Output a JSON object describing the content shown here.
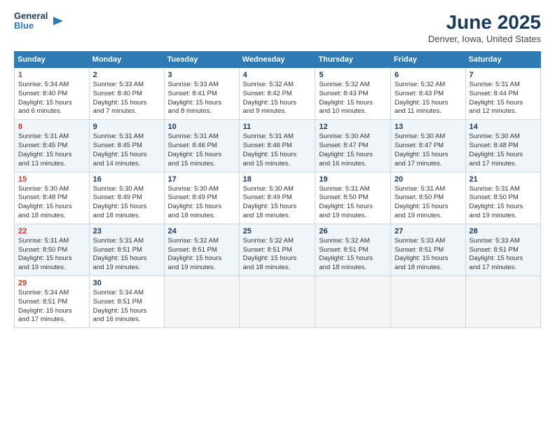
{
  "logo": {
    "line1": "General",
    "line2": "Blue"
  },
  "title": "June 2025",
  "location": "Denver, Iowa, United States",
  "days_of_week": [
    "Sunday",
    "Monday",
    "Tuesday",
    "Wednesday",
    "Thursday",
    "Friday",
    "Saturday"
  ],
  "weeks": [
    [
      {
        "day": "1",
        "info": "Sunrise: 5:34 AM\nSunset: 8:40 PM\nDaylight: 15 hours\nand 6 minutes."
      },
      {
        "day": "2",
        "info": "Sunrise: 5:33 AM\nSunset: 8:40 PM\nDaylight: 15 hours\nand 7 minutes."
      },
      {
        "day": "3",
        "info": "Sunrise: 5:33 AM\nSunset: 8:41 PM\nDaylight: 15 hours\nand 8 minutes."
      },
      {
        "day": "4",
        "info": "Sunrise: 5:32 AM\nSunset: 8:42 PM\nDaylight: 15 hours\nand 9 minutes."
      },
      {
        "day": "5",
        "info": "Sunrise: 5:32 AM\nSunset: 8:43 PM\nDaylight: 15 hours\nand 10 minutes."
      },
      {
        "day": "6",
        "info": "Sunrise: 5:32 AM\nSunset: 8:43 PM\nDaylight: 15 hours\nand 11 minutes."
      },
      {
        "day": "7",
        "info": "Sunrise: 5:31 AM\nSunset: 8:44 PM\nDaylight: 15 hours\nand 12 minutes."
      }
    ],
    [
      {
        "day": "8",
        "info": "Sunrise: 5:31 AM\nSunset: 8:45 PM\nDaylight: 15 hours\nand 13 minutes."
      },
      {
        "day": "9",
        "info": "Sunrise: 5:31 AM\nSunset: 8:45 PM\nDaylight: 15 hours\nand 14 minutes."
      },
      {
        "day": "10",
        "info": "Sunrise: 5:31 AM\nSunset: 8:46 PM\nDaylight: 15 hours\nand 15 minutes."
      },
      {
        "day": "11",
        "info": "Sunrise: 5:31 AM\nSunset: 8:46 PM\nDaylight: 15 hours\nand 15 minutes."
      },
      {
        "day": "12",
        "info": "Sunrise: 5:30 AM\nSunset: 8:47 PM\nDaylight: 15 hours\nand 16 minutes."
      },
      {
        "day": "13",
        "info": "Sunrise: 5:30 AM\nSunset: 8:47 PM\nDaylight: 15 hours\nand 17 minutes."
      },
      {
        "day": "14",
        "info": "Sunrise: 5:30 AM\nSunset: 8:48 PM\nDaylight: 15 hours\nand 17 minutes."
      }
    ],
    [
      {
        "day": "15",
        "info": "Sunrise: 5:30 AM\nSunset: 8:48 PM\nDaylight: 15 hours\nand 18 minutes."
      },
      {
        "day": "16",
        "info": "Sunrise: 5:30 AM\nSunset: 8:49 PM\nDaylight: 15 hours\nand 18 minutes."
      },
      {
        "day": "17",
        "info": "Sunrise: 5:30 AM\nSunset: 8:49 PM\nDaylight: 15 hours\nand 18 minutes."
      },
      {
        "day": "18",
        "info": "Sunrise: 5:30 AM\nSunset: 8:49 PM\nDaylight: 15 hours\nand 18 minutes."
      },
      {
        "day": "19",
        "info": "Sunrise: 5:31 AM\nSunset: 8:50 PM\nDaylight: 15 hours\nand 19 minutes."
      },
      {
        "day": "20",
        "info": "Sunrise: 5:31 AM\nSunset: 8:50 PM\nDaylight: 15 hours\nand 19 minutes."
      },
      {
        "day": "21",
        "info": "Sunrise: 5:31 AM\nSunset: 8:50 PM\nDaylight: 15 hours\nand 19 minutes."
      }
    ],
    [
      {
        "day": "22",
        "info": "Sunrise: 5:31 AM\nSunset: 8:50 PM\nDaylight: 15 hours\nand 19 minutes."
      },
      {
        "day": "23",
        "info": "Sunrise: 5:31 AM\nSunset: 8:51 PM\nDaylight: 15 hours\nand 19 minutes."
      },
      {
        "day": "24",
        "info": "Sunrise: 5:32 AM\nSunset: 8:51 PM\nDaylight: 15 hours\nand 19 minutes."
      },
      {
        "day": "25",
        "info": "Sunrise: 5:32 AM\nSunset: 8:51 PM\nDaylight: 15 hours\nand 18 minutes."
      },
      {
        "day": "26",
        "info": "Sunrise: 5:32 AM\nSunset: 8:51 PM\nDaylight: 15 hours\nand 18 minutes."
      },
      {
        "day": "27",
        "info": "Sunrise: 5:33 AM\nSunset: 8:51 PM\nDaylight: 15 hours\nand 18 minutes."
      },
      {
        "day": "28",
        "info": "Sunrise: 5:33 AM\nSunset: 8:51 PM\nDaylight: 15 hours\nand 17 minutes."
      }
    ],
    [
      {
        "day": "29",
        "info": "Sunrise: 5:34 AM\nSunset: 8:51 PM\nDaylight: 15 hours\nand 17 minutes."
      },
      {
        "day": "30",
        "info": "Sunrise: 5:34 AM\nSunset: 8:51 PM\nDaylight: 15 hours\nand 16 minutes."
      },
      {
        "day": "",
        "info": ""
      },
      {
        "day": "",
        "info": ""
      },
      {
        "day": "",
        "info": ""
      },
      {
        "day": "",
        "info": ""
      },
      {
        "day": "",
        "info": ""
      }
    ]
  ]
}
